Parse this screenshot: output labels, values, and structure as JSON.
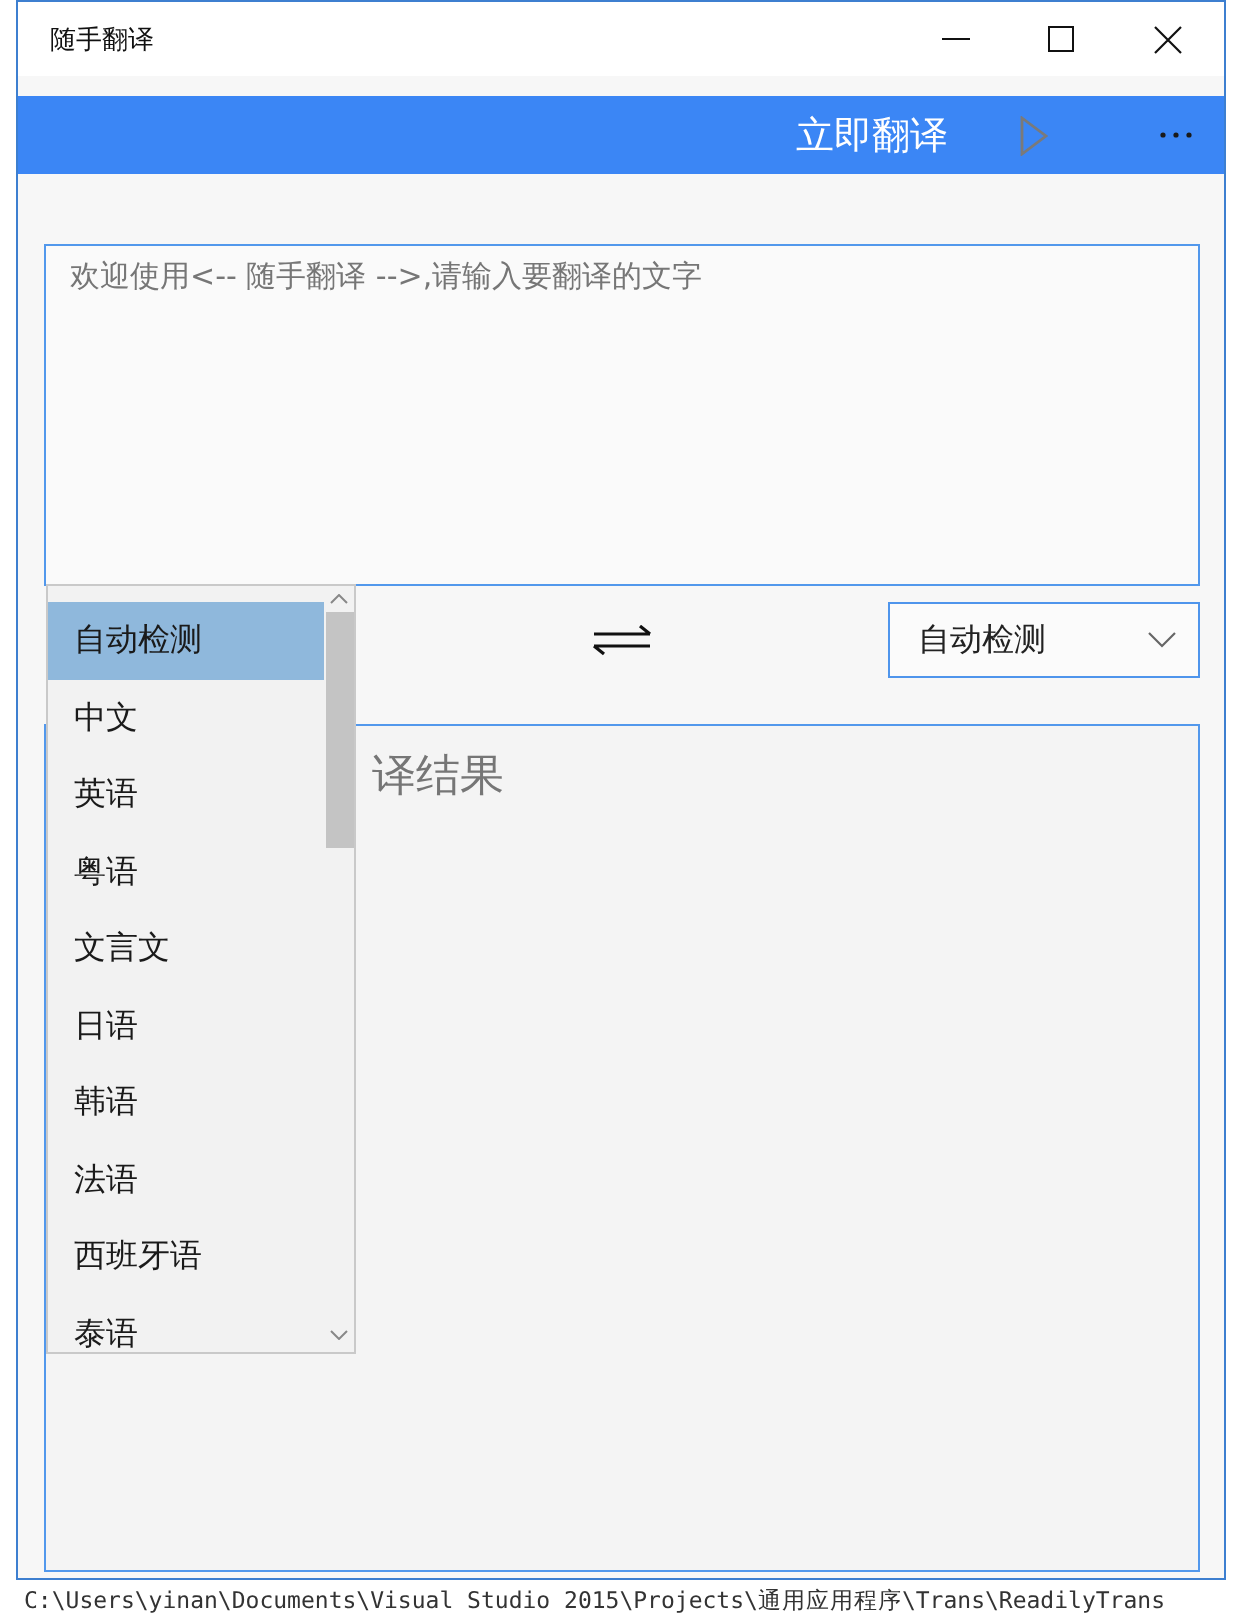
{
  "window": {
    "title": "随手翻译"
  },
  "command_bar": {
    "translate_label": "立即翻译"
  },
  "input": {
    "placeholder": "欢迎使用<-- 随手翻译 -->,请输入要翻译的文字"
  },
  "source_language": {
    "expanded": true,
    "items": [
      {
        "label": "自动检测",
        "selected": true
      },
      {
        "label": "中文",
        "selected": false
      },
      {
        "label": "英语",
        "selected": false
      },
      {
        "label": "粤语",
        "selected": false
      },
      {
        "label": "文言文",
        "selected": false
      },
      {
        "label": "日语",
        "selected": false
      },
      {
        "label": "韩语",
        "selected": false
      },
      {
        "label": "法语",
        "selected": false
      },
      {
        "label": "西班牙语",
        "selected": false
      },
      {
        "label": "泰语",
        "selected": false
      }
    ]
  },
  "target_language": {
    "value": "自动检测"
  },
  "output": {
    "placeholder": "译结果"
  },
  "background_text": "C:\\Users\\yinan\\Documents\\Visual Studio 2015\\Projects\\通用应用程序\\Trans\\ReadilyTrans"
}
